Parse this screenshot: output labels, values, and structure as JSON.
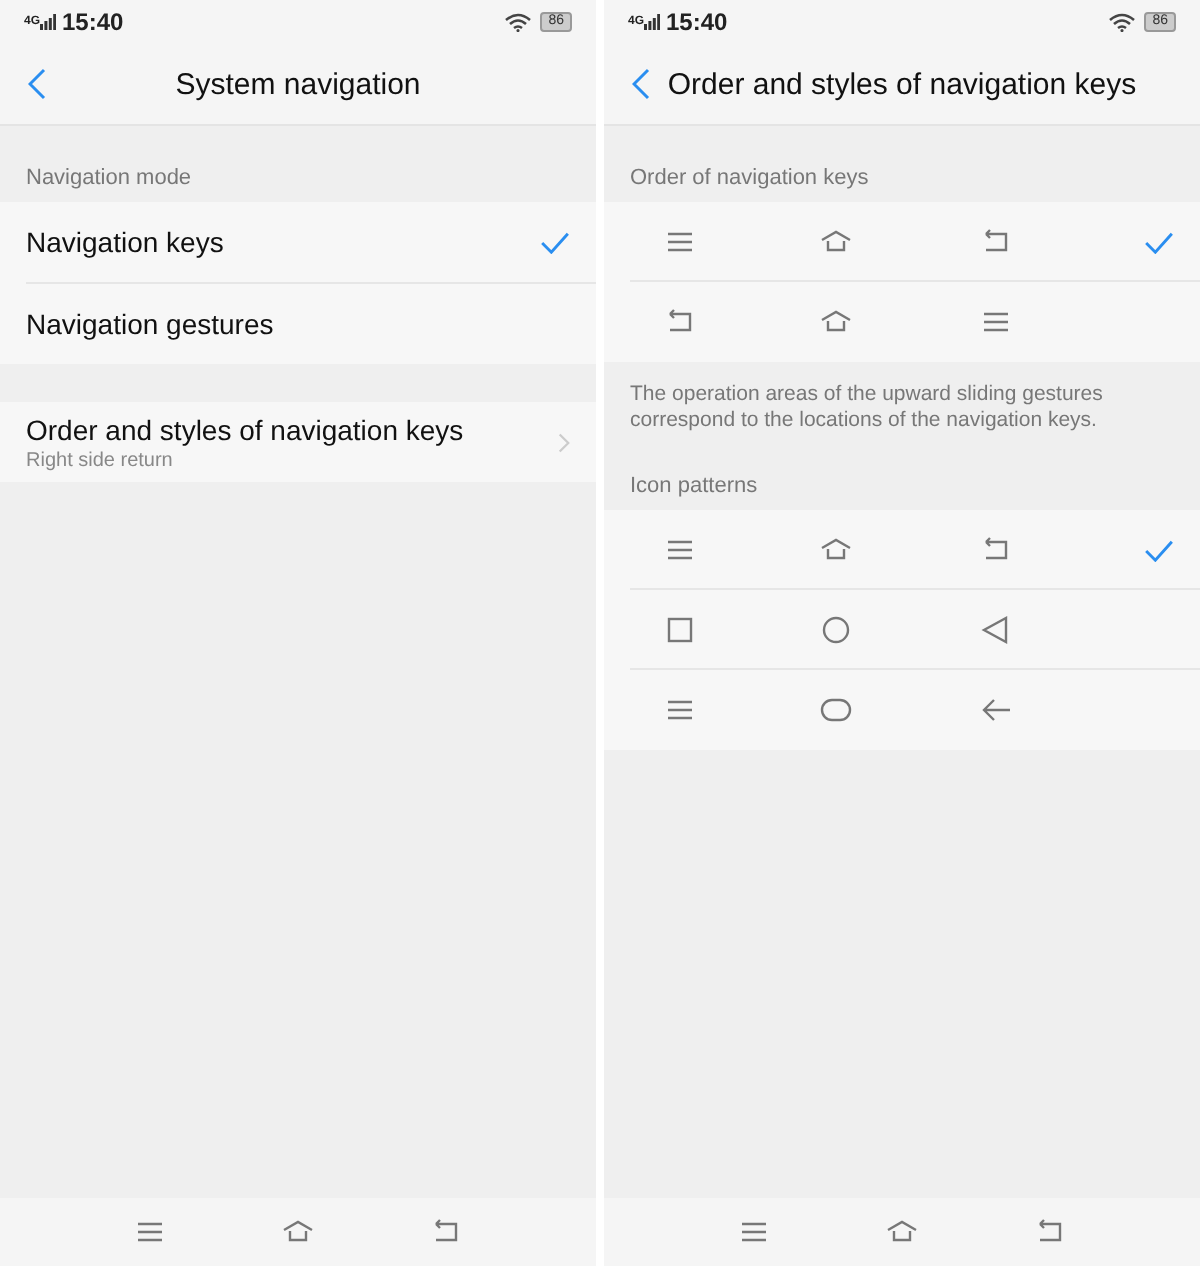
{
  "screens": [
    {
      "status_bar": {
        "network": "4G",
        "time": "15:40",
        "battery": "86"
      },
      "title": "System navigation",
      "blocks": [
        {
          "kind": "section",
          "label": "Navigation mode",
          "rows": [
            {
              "kind": "choice",
              "label": "Navigation keys",
              "selected": true
            },
            {
              "kind": "choice",
              "label": "Navigation gestures",
              "selected": false
            }
          ]
        },
        {
          "kind": "section",
          "rows": [
            {
              "kind": "link",
              "label": "Order and styles of navigation keys",
              "subtitle": "Right side return"
            }
          ]
        }
      ],
      "nav_keys": [
        {
          "kind": "menu"
        },
        {
          "kind": "home"
        },
        {
          "kind": "back"
        }
      ]
    },
    {
      "status_bar": {
        "network": "4G",
        "time": "15:40",
        "battery": "86"
      },
      "title": "Order and styles of navigation keys",
      "blocks": [
        {
          "kind": "section",
          "label": "Order of navigation keys",
          "rows": [
            {
              "kind": "icons",
              "icons": [
                {
                  "kind": "menu"
                },
                {
                  "kind": "home"
                },
                {
                  "kind": "back"
                }
              ],
              "selected": true
            },
            {
              "kind": "icons",
              "icons": [
                {
                  "kind": "back"
                },
                {
                  "kind": "home"
                },
                {
                  "kind": "menu"
                }
              ],
              "selected": false
            }
          ]
        },
        {
          "kind": "note",
          "text": "The operation areas of the upward sliding gestures correspond to the locations of the navigation keys."
        },
        {
          "kind": "section",
          "label": "Icon patterns",
          "rows": [
            {
              "kind": "icons",
              "icons": [
                {
                  "kind": "menu"
                },
                {
                  "kind": "home"
                },
                {
                  "kind": "back"
                }
              ],
              "selected": true
            },
            {
              "kind": "icons",
              "icons": [
                {
                  "kind": "square"
                },
                {
                  "kind": "circle"
                },
                {
                  "kind": "triangle"
                }
              ],
              "selected": false
            },
            {
              "kind": "icons",
              "icons": [
                {
                  "kind": "menu"
                },
                {
                  "kind": "pill"
                },
                {
                  "kind": "arrow"
                }
              ],
              "selected": false
            }
          ]
        }
      ],
      "nav_keys": [
        {
          "kind": "menu"
        },
        {
          "kind": "home"
        },
        {
          "kind": "back"
        }
      ]
    }
  ]
}
